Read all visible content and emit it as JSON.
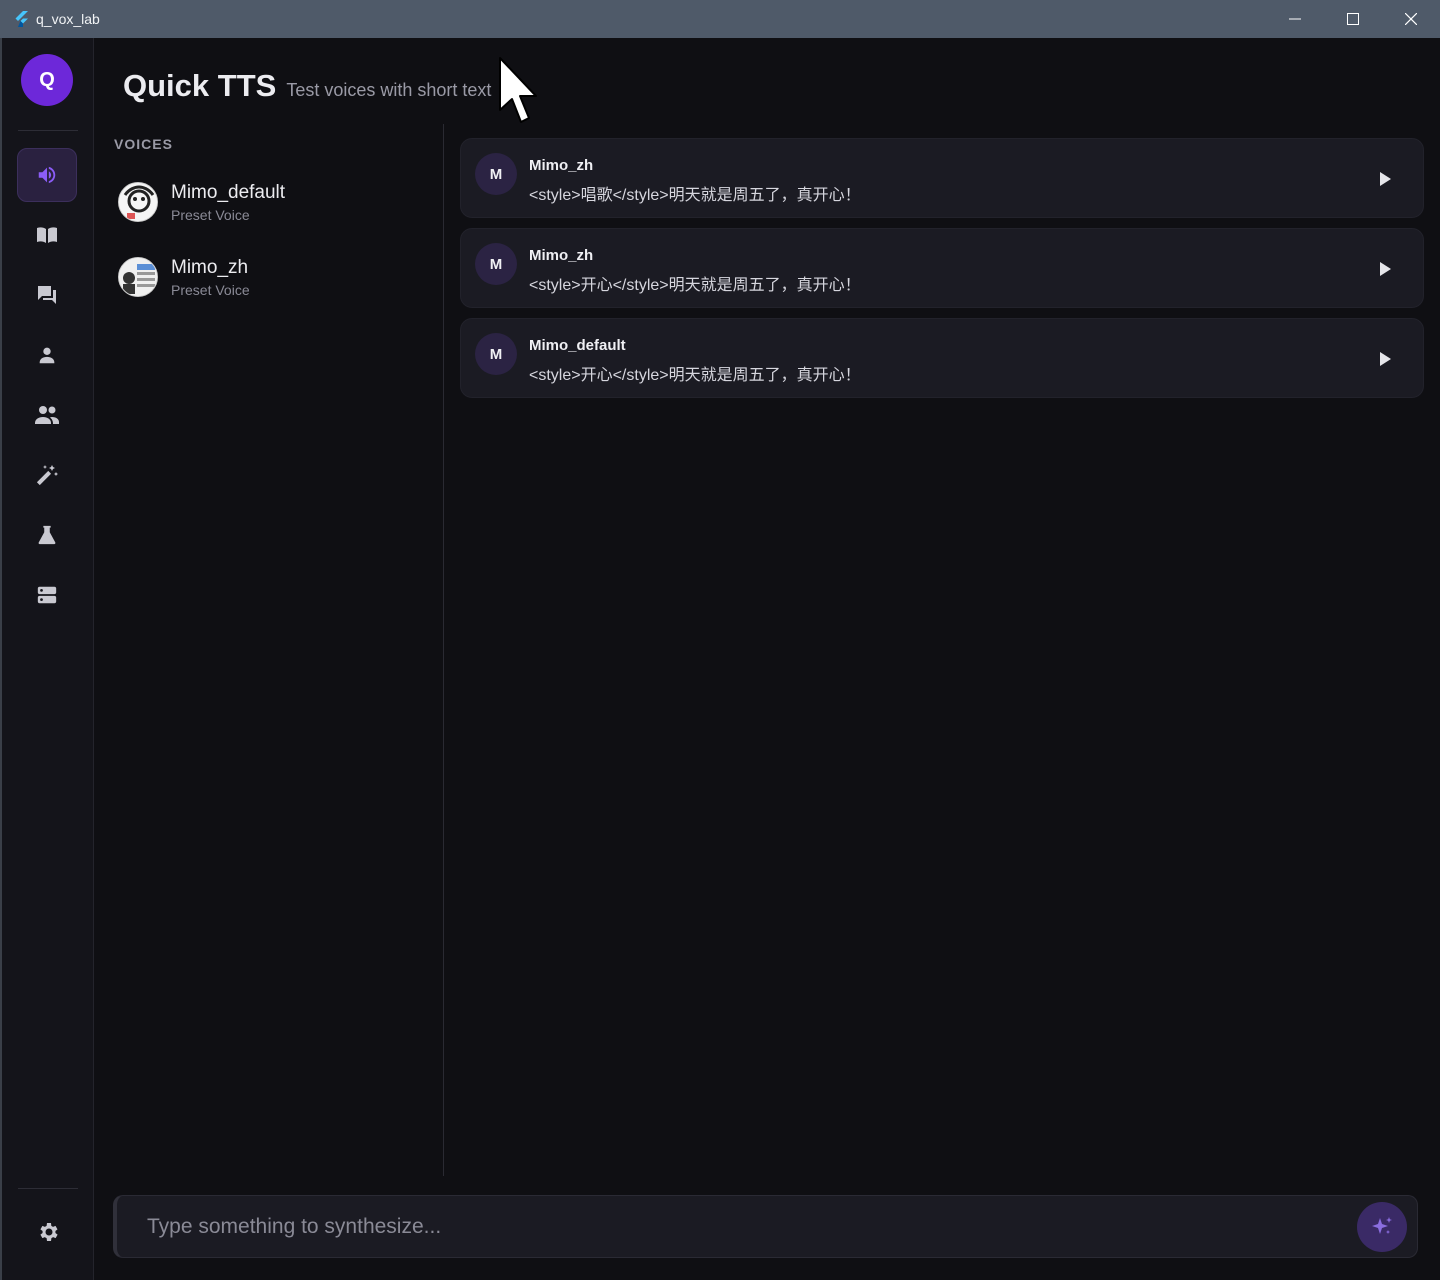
{
  "window": {
    "title": "q_vox_lab",
    "controls": [
      "minimize-icon",
      "maximize-icon",
      "close-icon"
    ]
  },
  "sidebar": {
    "logo": "Q",
    "accent": "#6d28d9",
    "items": [
      {
        "icon": "speaker-icon",
        "active": true
      },
      {
        "icon": "book-icon",
        "active": false
      },
      {
        "icon": "chat-icon",
        "active": false
      },
      {
        "icon": "person-icon",
        "active": false
      },
      {
        "icon": "people-icon",
        "active": false
      },
      {
        "icon": "magic-wand-icon",
        "active": false
      },
      {
        "icon": "flask-icon",
        "active": false
      },
      {
        "icon": "server-icon",
        "active": false
      }
    ],
    "settings_icon": "gear-icon"
  },
  "header": {
    "title": "Quick TTS",
    "subtitle": "Test voices with short text"
  },
  "voices": {
    "label": "VOICES",
    "items": [
      {
        "name": "Mimo_default",
        "type": "Preset Voice"
      },
      {
        "name": "Mimo_zh",
        "type": "Preset Voice"
      }
    ]
  },
  "history": [
    {
      "avatar": "M",
      "voice": "Mimo_zh",
      "text": "<style>唱歌</style>明天就是周五了，真开心！"
    },
    {
      "avatar": "M",
      "voice": "Mimo_zh",
      "text": "<style>开心</style>明天就是周五了，真开心！"
    },
    {
      "avatar": "M",
      "voice": "Mimo_default",
      "text": "<style>开心</style>明天就是周五了，真开心！"
    }
  ],
  "input": {
    "placeholder": "Type something to synthesize...",
    "value": ""
  }
}
